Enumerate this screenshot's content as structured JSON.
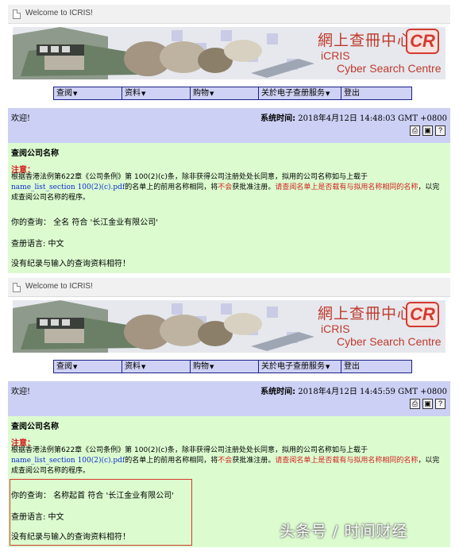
{
  "colors": {
    "menu_bg": "#cfd2f4",
    "welcome_bg": "#ccd0f4",
    "content_bg": "#dcfcd0",
    "warning_red": "#d21f1f",
    "link_blue": "#0e2bd0",
    "brand_red": "#c0392b"
  },
  "screens": [
    {
      "tab_title": "Welcome to ICRIS!",
      "banner": {
        "zh_title": "網上查冊中心",
        "cr_logo": "CR",
        "en_line1": "iCRIS",
        "en_line2": "Cyber Search Centre"
      },
      "menu": [
        {
          "label": "查阅",
          "icon": "caret-down-icon"
        },
        {
          "label": "资料",
          "icon": "caret-down-icon"
        },
        {
          "label": "购物",
          "icon": "caret-down-icon"
        },
        {
          "label": "关於电子查册服务",
          "icon": "caret-down-icon"
        },
        {
          "label": "登出"
        }
      ],
      "welcome": "欢迎!",
      "system_time_label": "系统时间:",
      "system_time": "2018年4月12日 14:48:03 GMT +0800",
      "toolbar_icons": [
        "printer-icon",
        "save-icon",
        "help-icon"
      ],
      "heading": "查阅公司名称",
      "note_label": "注意：",
      "notice": {
        "part1": "根据香港法例第622章《公司条例》第 100(2)(c)条，除非获得公司注册处处长同意，拟用的公司名称如与上载于",
        "link": "name_list_section 100(2)(c).pdf",
        "part2": "的名单上的前用名称相同，将",
        "red1": "不会",
        "part3": "获批准注册。",
        "red2": "请查阅名单上是否载有与拟用名称相同的名称",
        "part4": "，以完成查阅公司名称的程序。"
      },
      "query": "你的查询：  全名 符合 '长江金业有限公司'",
      "language": "查册语言: 中文",
      "result": "没有纪录与输入的查询资料相符！"
    },
    {
      "tab_title": "Welcome to ICRIS!",
      "banner": {
        "zh_title": "網上查冊中心",
        "cr_logo": "CR",
        "en_line1": "iCRIS",
        "en_line2": "Cyber Search Centre"
      },
      "menu": [
        {
          "label": "查阅",
          "icon": "caret-down-icon"
        },
        {
          "label": "资料",
          "icon": "caret-down-icon"
        },
        {
          "label": "购物",
          "icon": "caret-down-icon"
        },
        {
          "label": "关於电子查册服务",
          "icon": "caret-down-icon"
        },
        {
          "label": "登出"
        }
      ],
      "welcome": "欢迎!",
      "system_time_label": "系统时间:",
      "system_time": "2018年4月12日 14:45:59 GMT +0800",
      "toolbar_icons": [
        "printer-icon",
        "save-icon",
        "help-icon"
      ],
      "heading": "查阅公司名称",
      "note_label": "注意：",
      "notice": {
        "part1": "根据香港法例第622章《公司条例》第 100(2)(c)条，除非获得公司注册处处长同意，拟用的公司名称如与上载于",
        "link": "name_list_section 100(2)(c).pdf",
        "part2": "的名单上的前用名称相同，将",
        "red1": "不会",
        "part3": "获批准注册。",
        "red2": "请查阅名单上是否载有与拟用名称相同的名称",
        "part4": "，以完成查阅公司名称的程序。"
      },
      "query": "你的查询：  名称起首 符合 '长江金业有限公司'",
      "language": "查册语言: 中文",
      "result": "没有纪录与输入的查询资料相符！"
    }
  ],
  "watermark": "头条号 / 时间财经"
}
